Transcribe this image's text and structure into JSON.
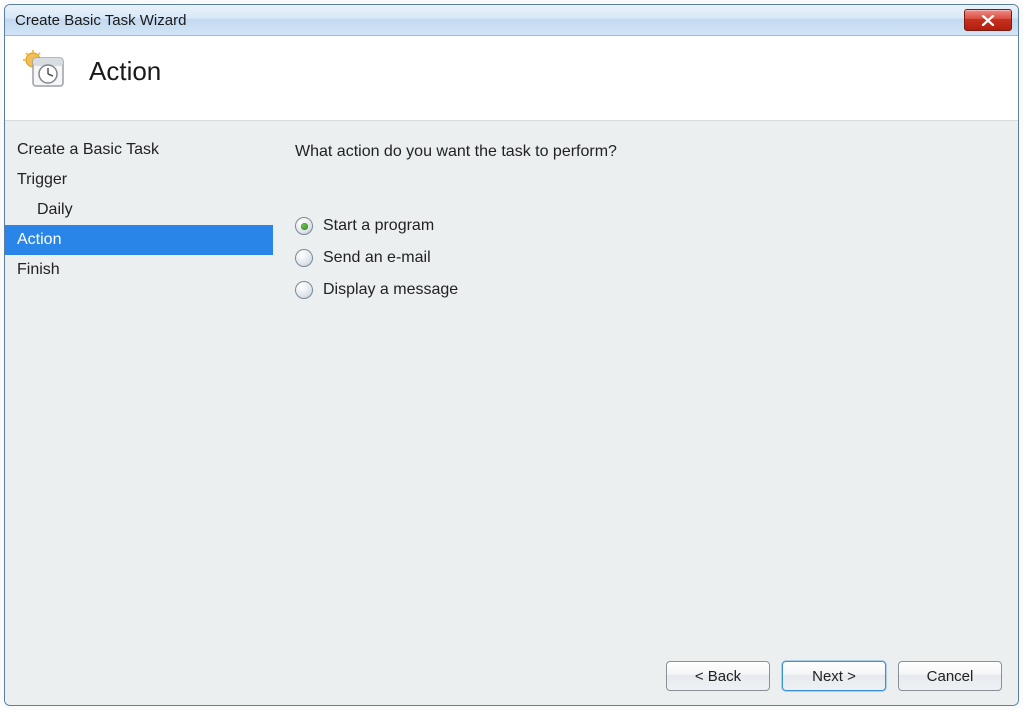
{
  "window": {
    "title": "Create Basic Task Wizard"
  },
  "header": {
    "title": "Action",
    "icon": "task-schedule-icon"
  },
  "sidebar": {
    "items": [
      {
        "label": "Create a Basic Task",
        "sub": false,
        "selected": false
      },
      {
        "label": "Trigger",
        "sub": false,
        "selected": false
      },
      {
        "label": "Daily",
        "sub": true,
        "selected": false
      },
      {
        "label": "Action",
        "sub": false,
        "selected": true
      },
      {
        "label": "Finish",
        "sub": false,
        "selected": false
      }
    ]
  },
  "content": {
    "prompt": "What action do you want the task to perform?",
    "options": [
      {
        "label": "Start a program",
        "checked": true
      },
      {
        "label": "Send an e-mail",
        "checked": false
      },
      {
        "label": "Display a message",
        "checked": false
      }
    ]
  },
  "footer": {
    "back": "< Back",
    "next": "Next >",
    "cancel": "Cancel"
  }
}
